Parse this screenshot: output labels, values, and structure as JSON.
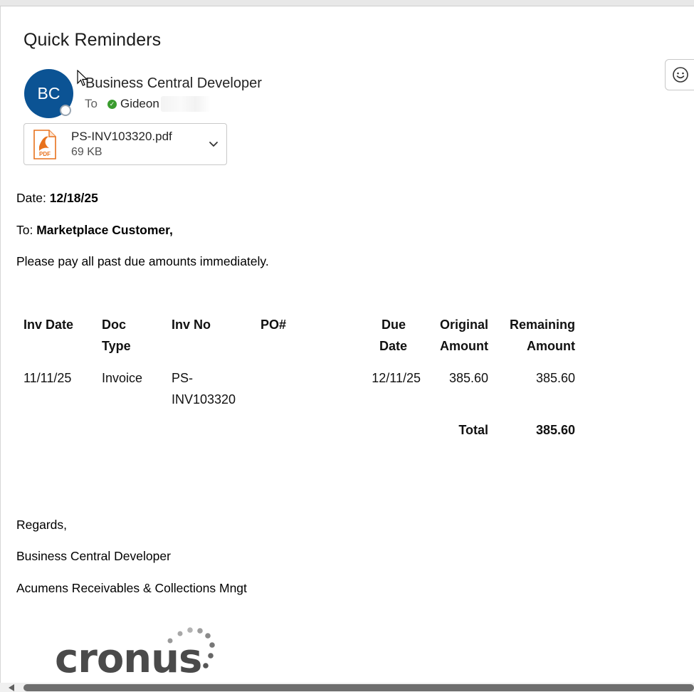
{
  "email": {
    "subject": "Quick Reminders",
    "avatar_initials": "BC",
    "sender": "Business Central Developer",
    "to_label": "To",
    "recipient": "Gideon",
    "colors": {
      "avatar": "#0b5394",
      "presence_check": "#3a9c2e",
      "pdf_orange": "#e8711c"
    }
  },
  "attachment": {
    "filename": "PS-INV103320.pdf",
    "size": "69 KB",
    "icon": "pdf-icon",
    "icon_label": "PDF"
  },
  "body": {
    "date_label": "Date:",
    "date_value": "12/18/25",
    "to_label": "To:",
    "to_value": "Marketplace Customer,",
    "message": "Please pay all past due amounts immediately."
  },
  "table": {
    "headers": {
      "inv_date": "Inv Date",
      "doc_type_1": "Doc",
      "doc_type_2": "Type",
      "inv_no": "Inv No",
      "po": "PO#",
      "due_date_1": "Due",
      "due_date_2": "Date",
      "original_1": "Original",
      "original_2": "Amount",
      "remaining_1": "Remaining",
      "remaining_2": "Amount"
    },
    "rows": [
      {
        "inv_date": "11/11/25",
        "doc_type": "Invoice",
        "inv_no_1": "PS-",
        "inv_no_2": "INV103320",
        "po": "",
        "due_date": "12/11/25",
        "original": "385.60",
        "remaining": "385.60"
      }
    ],
    "total_label": "Total",
    "total_value": "385.60"
  },
  "signature": {
    "regards": "Regards,",
    "name": "Business Central Developer",
    "company": "Acumens Receivables & Collections Mngt",
    "logo_text": "cronus"
  }
}
